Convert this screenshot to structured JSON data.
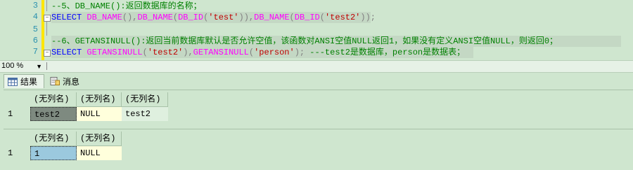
{
  "editor": {
    "line_numbers": [
      "3",
      "4",
      "5",
      "6",
      "7"
    ],
    "line3": {
      "comment": "--5、DB_NAME():返回数据库的名称；"
    },
    "line4": {
      "kw_select": "SELECT",
      "fn1": "DB_NAME",
      "p1": "(),",
      "fn2": "DB_NAME",
      "p2": "(",
      "fn3": "DB_ID",
      "p3": "(",
      "str1": "'test'",
      "p4": ")),",
      "fn4": "DB_NAME",
      "p5": "(",
      "fn5": "DB_ID",
      "p6": "(",
      "str2": "'test2'",
      "p7": "));"
    },
    "line6": {
      "comment": "--6、GETANSINULL():返回当前数据库默认是否允许空值，该函数对ANSI空值NULL返回1，如果没有定义ANSI空值NULL，则返回0；"
    },
    "line7": {
      "kw_select": "SELECT",
      "fn1": "GETANSINULL",
      "p1": "(",
      "str1": "'test2'",
      "p2": "),",
      "fn2": "GETANSINULL",
      "p3": "(",
      "str2": "'person'",
      "p4": ");",
      "comment": " ---test2是数据库，person是数据表；"
    }
  },
  "zoom": {
    "value": "100 %"
  },
  "tabs": {
    "results": "结果",
    "messages": "消息"
  },
  "grid1": {
    "headers": [
      "(无列名)",
      "(无列名)",
      "(无列名)"
    ],
    "row_number": "1",
    "cells": [
      "test2",
      "NULL",
      "test2"
    ]
  },
  "grid2": {
    "headers": [
      "(无列名)",
      "(无列名)"
    ],
    "row_number": "1",
    "cells": [
      "1",
      "NULL"
    ]
  }
}
